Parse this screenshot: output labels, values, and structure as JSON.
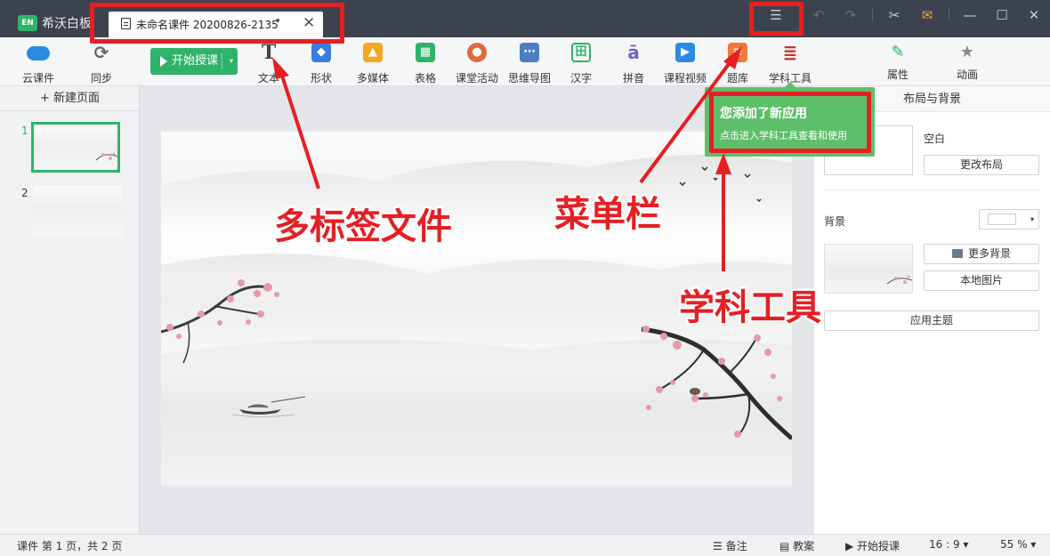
{
  "app": {
    "logo_text": "EN",
    "name": "希沃白板"
  },
  "tab": {
    "title": "未命名课件 20200826-2135",
    "caret": "▾",
    "close": "✕"
  },
  "window_controls": {
    "menu": "☰",
    "undo": "↶",
    "redo": "↷",
    "minimize": "—",
    "maximize": "☐",
    "close": "✕"
  },
  "toolbar": {
    "left_tools": [
      {
        "label": "云课件",
        "icon": "cloud-icon",
        "color": "#2b8be0"
      },
      {
        "label": "同步",
        "icon": "sync-icon",
        "color": "#666666"
      }
    ],
    "start_button": {
      "label": "开始授课",
      "caret": "▾"
    },
    "tools": [
      {
        "label": "文本",
        "icon": "text-icon",
        "color": "#555555",
        "glyph": "T"
      },
      {
        "label": "形状",
        "icon": "shape-icon",
        "color": "#3a7be0",
        "glyph": "◆"
      },
      {
        "label": "多媒体",
        "icon": "image-icon",
        "color": "#f5a623",
        "glyph": "▲"
      },
      {
        "label": "表格",
        "icon": "table-icon",
        "color": "#2fb36b",
        "glyph": "▦"
      },
      {
        "label": "课堂活动",
        "icon": "activity-icon",
        "color": "#e06a3a",
        "glyph": "●"
      },
      {
        "label": "思维导图",
        "icon": "mindmap-icon",
        "color": "#4a7fc1",
        "glyph": "⋯"
      },
      {
        "label": "汉字",
        "icon": "hanzi-icon",
        "color": "#2fb36b",
        "glyph": "田"
      },
      {
        "label": "拼音",
        "icon": "pinyin-icon",
        "color": "#7a5cc8",
        "glyph": "ā"
      },
      {
        "label": "课程视频",
        "icon": "video-icon",
        "color": "#2b8be0",
        "glyph": "▶"
      },
      {
        "label": "题库",
        "icon": "question-bank-icon",
        "color": "#f07a3a",
        "glyph": "≡"
      },
      {
        "label": "学科工具",
        "icon": "subject-tools-icon",
        "color": "#c0392b",
        "glyph": "≣"
      }
    ],
    "right_tools": [
      {
        "label": "属性",
        "icon": "brush-icon",
        "color": "#2fb36b"
      },
      {
        "label": "动画",
        "icon": "star-icon",
        "color": "#888888"
      }
    ]
  },
  "left_panel": {
    "new_page": "+ 新建页面",
    "pages": [
      {
        "number": "1"
      },
      {
        "number": "2"
      }
    ]
  },
  "right_panel": {
    "tab_title": "布局与背景",
    "layout_name": "空白",
    "change_layout": "更改布局",
    "background_label": "背景",
    "more_backgrounds": "更多背景",
    "local_image": "本地图片",
    "apply_theme": "应用主题"
  },
  "popup": {
    "title": "您添加了新应用",
    "subtitle": "点击进入学科工具查看和使用"
  },
  "status_bar": {
    "page_info": "课件 第 1 页，共 2 页",
    "notes": "备注",
    "lesson_plan": "教案",
    "start_teaching": "开始授课",
    "aspect_ratio": "16 : 9 ▾",
    "zoom": "55 % ▾"
  },
  "annotations": {
    "multi_tab": "多标签文件",
    "menu_bar": "菜单栏",
    "subject_tools": "学科工具",
    "color": "#e51f23"
  }
}
